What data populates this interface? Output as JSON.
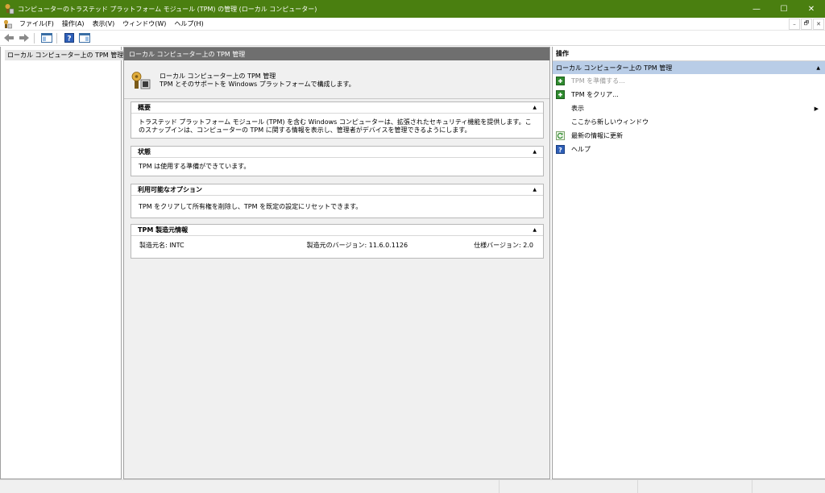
{
  "window": {
    "title": "コンピューターのトラステッド プラットフォーム モジュール (TPM) の管理 (ローカル コンピューター)",
    "minimize": "—",
    "maximize": "☐",
    "close": "✕"
  },
  "menu": {
    "items": [
      "ファイル(F)",
      "操作(A)",
      "表示(V)",
      "ウィンドウ(W)",
      "ヘルプ(H)"
    ],
    "mdi": [
      "–",
      "🗗",
      "✕"
    ]
  },
  "tree": {
    "root_label": "ローカル コンピューター上の TPM 管理"
  },
  "center": {
    "header": "ローカル コンピューター上の TPM 管理",
    "intro_line1": "ローカル コンピューター上の TPM 管理",
    "intro_line2": "TPM とそのサポートを Windows プラットフォームで構成します。",
    "overview": {
      "title": "概要",
      "body": "トラステッド プラットフォーム モジュール (TPM) を含む Windows コンピューターは、拡張されたセキュリティ機能を提供します。このスナップインは、コンピューターの TPM に関する情報を表示し、管理者がデバイスを管理できるようにします。"
    },
    "status": {
      "title": "状態",
      "body": "TPM は使用する準備ができています。"
    },
    "options": {
      "title": "利用可能なオプション",
      "body": "TPM をクリアして所有権を削除し、TPM を既定の設定にリセットできます。"
    },
    "manufacturer": {
      "title": "TPM 製造元情報",
      "name_label": "製造元名: INTC",
      "version_label": "製造元のバージョン: 11.6.0.1126",
      "spec_label": "仕様バージョン: 2.0"
    },
    "collapse_glyph": "▲"
  },
  "actions": {
    "title": "操作",
    "group_label": "ローカル コンピューター上の TPM 管理",
    "group_arrow": "▲",
    "items": [
      {
        "label": "TPM を準備する...",
        "icon": "green-plus-icon"
      },
      {
        "label": "TPM をクリア...",
        "icon": "green-plus-icon"
      },
      {
        "label": "表示",
        "icon": "none"
      },
      {
        "label": "ここから新しいウィンドウ",
        "icon": "none"
      },
      {
        "label": "最新の情報に更新",
        "icon": "refresh-icon"
      },
      {
        "label": "ヘルプ",
        "icon": "help-icon"
      }
    ],
    "submenu_arrow": "▶"
  },
  "colors": {
    "titlebar": "#4a7f10",
    "actions_group": "#b9cde7",
    "center_header": "#6f6f6f"
  }
}
